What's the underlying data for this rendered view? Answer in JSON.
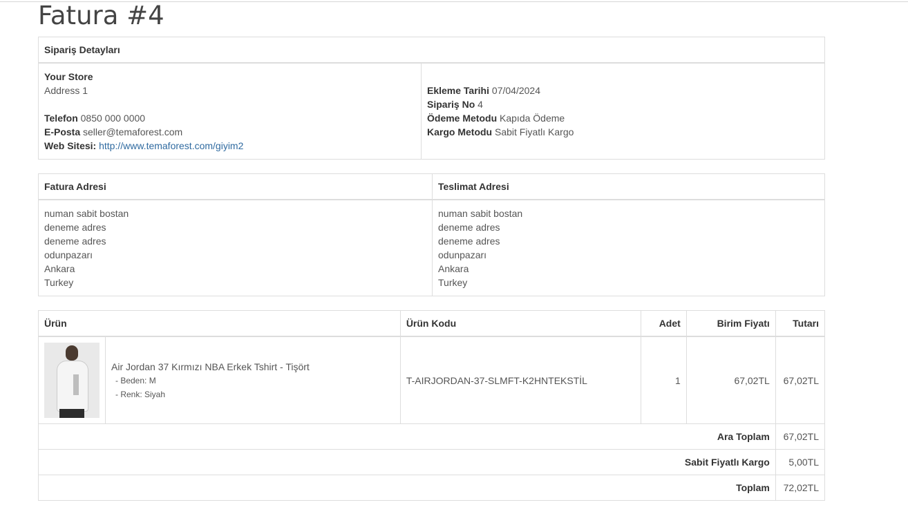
{
  "page": {
    "title": "Fatura #4"
  },
  "order": {
    "header": "Sipariş Detayları",
    "store": {
      "name": "Your Store",
      "address": "Address 1",
      "phone_label": "Telefon",
      "phone": "0850 000 0000",
      "email_label": "E-Posta",
      "email": "seller@temaforest.com",
      "web_label": "Web Sitesi:",
      "web": "http://www.temaforest.com/giyim2"
    },
    "meta": {
      "date_label": "Ekleme Tarihi",
      "date": "07/04/2024",
      "no_label": "Sipariş No",
      "no": "4",
      "payment_label": "Ödeme Metodu",
      "payment": "Kapıda Ödeme",
      "shipping_label": "Kargo Metodu",
      "shipping": "Sabit Fiyatlı Kargo"
    }
  },
  "addresses": {
    "billing_header": "Fatura Adresi",
    "shipping_header": "Teslimat Adresi",
    "billing": [
      "numan sabit bostan",
      "deneme adres",
      "deneme adres",
      "odunpazarı",
      "Ankara",
      "Turkey"
    ],
    "shipping": [
      "numan sabit bostan",
      "deneme adres",
      "deneme adres",
      "odunpazarı",
      "Ankara",
      "Turkey"
    ]
  },
  "products": {
    "headers": {
      "product": "Ürün",
      "code": "Ürün Kodu",
      "qty": "Adet",
      "unit": "Birim Fiyatı",
      "total": "Tutarı"
    },
    "items": [
      {
        "name": "Air Jordan 37 Kırmızı NBA Erkek Tshirt - Tişört",
        "opt1": "- Beden: M",
        "opt2": "- Renk: Siyah",
        "code": "T-AIRJORDAN-37-SLMFT-K2HNTEKSTİL",
        "qty": "1",
        "unit": "67,02TL",
        "total": "67,02TL"
      }
    ],
    "totals": [
      {
        "label": "Ara Toplam",
        "value": "67,02TL"
      },
      {
        "label": "Sabit Fiyatlı Kargo",
        "value": "5,00TL"
      },
      {
        "label": "Toplam",
        "value": "72,02TL"
      }
    ]
  }
}
